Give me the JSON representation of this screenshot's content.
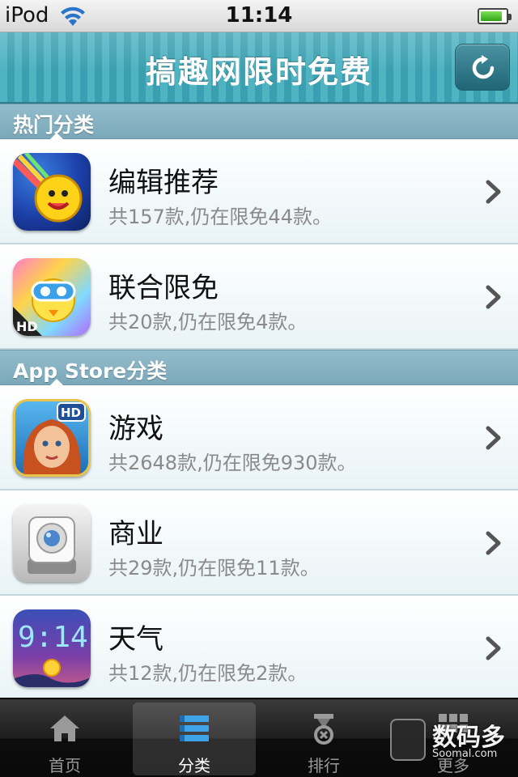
{
  "status_bar": {
    "carrier": "iPod",
    "time": "11:14",
    "wifi_icon": "wifi-icon",
    "battery_icon": "battery-icon"
  },
  "nav": {
    "title": "搞趣网限时免费",
    "refresh_icon": "refresh-icon"
  },
  "sections": [
    {
      "header": "热门分类",
      "rows": [
        {
          "title": "编辑推荐",
          "subtitle": "共157款,仍在限免44款。",
          "icon": "editor-pick-app-icon"
        },
        {
          "title": "联合限免",
          "subtitle": "共20款,仍在限免4款。",
          "icon": "joint-free-app-icon"
        }
      ]
    },
    {
      "header": "App Store分类",
      "rows": [
        {
          "title": "游戏",
          "subtitle": "共2648款,仍在限免930款。",
          "icon": "games-app-icon"
        },
        {
          "title": "商业",
          "subtitle": "共29款,仍在限免11款。",
          "icon": "business-app-icon"
        },
        {
          "title": "天气",
          "subtitle": "共12款,仍在限免2款。",
          "icon": "weather-app-icon"
        }
      ]
    }
  ],
  "tabbar": {
    "tabs": [
      {
        "label": "首页",
        "icon": "home-icon",
        "active": false
      },
      {
        "label": "分类",
        "icon": "list-icon",
        "active": true
      },
      {
        "label": "排行",
        "icon": "medal-icon",
        "active": false
      },
      {
        "label": "更多",
        "icon": "grid-icon",
        "active": false
      }
    ]
  },
  "watermark": {
    "text": "数码多",
    "sub": "Soomal.com"
  },
  "colors": {
    "nav_teal": "#4fb3c2",
    "section_header": "#7ba9ba",
    "subtitle_gray": "#8a8a8a",
    "tab_active_label": "#ffffff"
  }
}
